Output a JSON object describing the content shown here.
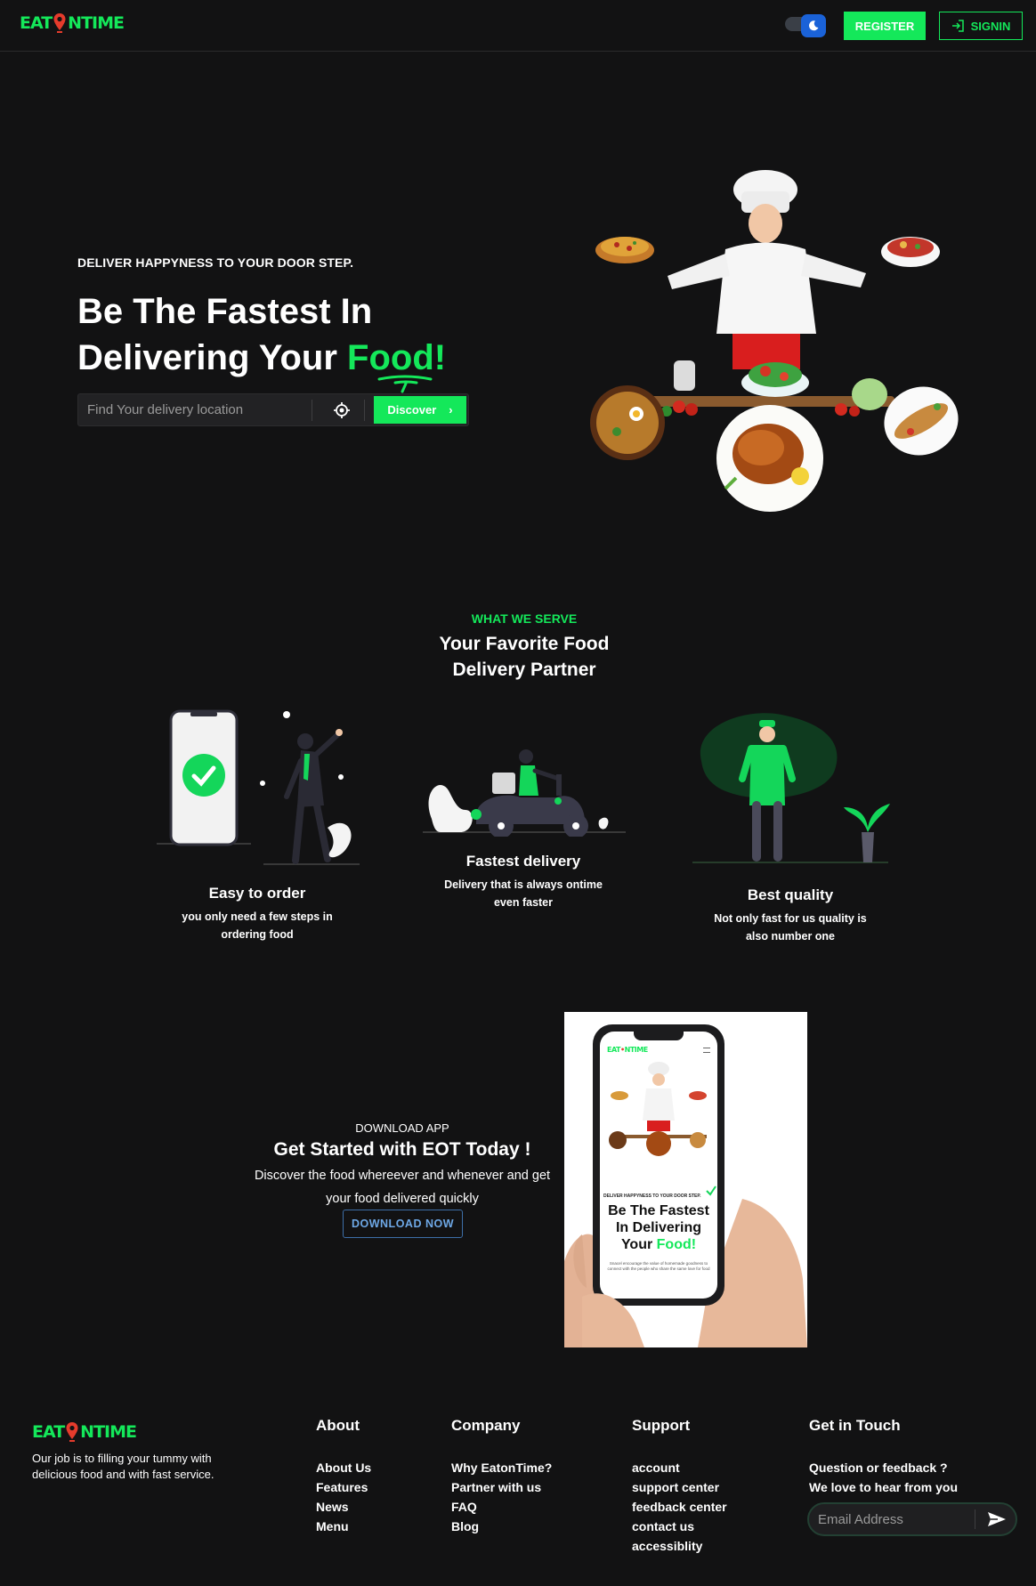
{
  "brand": {
    "logo_left": "EAT",
    "logo_right": "NTIME",
    "accent": "#14e85a",
    "bg": "#121213",
    "pin_color": "#e53b2c"
  },
  "header": {
    "register_label": "REGISTER",
    "signin_label": "SIGNIN",
    "signin_icon": "login-icon",
    "theme_toggle_icon": "moon-icon"
  },
  "hero": {
    "eyebrow": "DELIVER HAPPYNESS TO YOUR DOOR STEP.",
    "title_line1": "Be The Fastest In",
    "title_line2_start": "Delivering Your ",
    "title_highlight": "Food!",
    "search_placeholder": "Find Your delivery location",
    "locate_icon": "crosshair-icon",
    "discover_label": "Discover",
    "image": "chef-with-dishes"
  },
  "serve": {
    "eyebrow": "WHAT WE SERVE",
    "title_line1": "Your Favorite Food",
    "title_line2": "Delivery Partner",
    "features": [
      {
        "title": "Easy to order",
        "line1": "you only need a few steps in",
        "line2": "ordering food",
        "illustration": "phone-checkmark"
      },
      {
        "title": "Fastest delivery",
        "line1": "Delivery that is always ontime",
        "line2": "even faster",
        "illustration": "scooter-rider"
      },
      {
        "title": "Best quality",
        "line1": "Not only fast for us quality is",
        "line2": "also number one",
        "illustration": "chef-plant"
      }
    ]
  },
  "download": {
    "eyebrow": "DOWNLOAD APP",
    "title": "Get Started with EOT Today !",
    "text": "Discover the food whereever and whenever and get your food delivered quickly",
    "button_label": "DOWNLOAD NOW",
    "mockup": {
      "eyebrow": "DELIVER HAPPYNESS TO YOUR DOOR STEP.",
      "title_line1": "Be The Fastest",
      "title_line2": "In Delivering",
      "title_line3_start": "Your ",
      "title_highlight": "Food!",
      "tiny_text": "Snacel encourage the value of homemade goodness to connect with the people who share the same love for food"
    }
  },
  "footer": {
    "description": "Our job is to filling your tummy with delicious food and with fast service.",
    "columns": [
      {
        "heading": "About",
        "links": [
          "About Us",
          "Features",
          "News",
          "Menu"
        ]
      },
      {
        "heading": "Company",
        "links": [
          "Why EatonTime?",
          "Partner with us",
          "FAQ",
          "Blog"
        ]
      },
      {
        "heading": "Support",
        "links": [
          "account",
          "support center",
          "feedback center",
          "contact us",
          "accessiblity"
        ]
      }
    ],
    "touch": {
      "heading": "Get in Touch",
      "line1": "Question or feedback ?",
      "line2": "We love to hear from you",
      "email_placeholder": "Email Address",
      "send_icon": "send-icon"
    }
  }
}
